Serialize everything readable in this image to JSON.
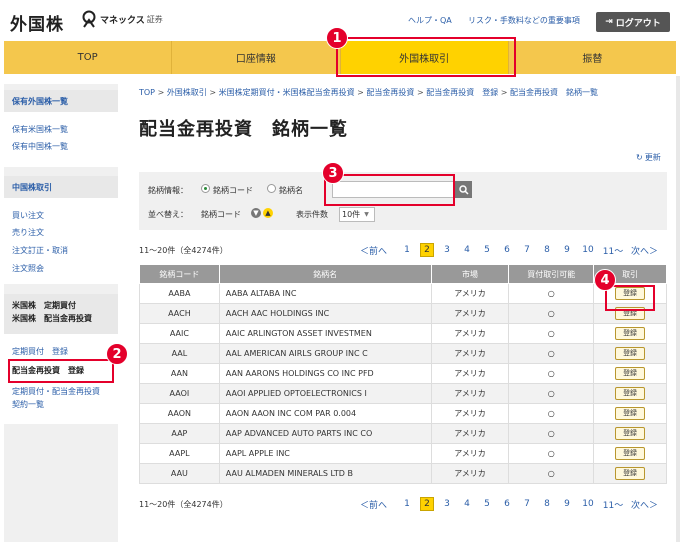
{
  "header": {
    "brand": "外国株",
    "logo_text": "マネックス",
    "logo_sub": "証券",
    "help_link": "ヘルプ・QA",
    "fees_link": "リスク・手数料などの重要事項",
    "logout_label": "ログアウト"
  },
  "nav": {
    "tabs": [
      {
        "label": "TOP"
      },
      {
        "label": "口座情報"
      },
      {
        "label": "外国株取引"
      },
      {
        "label": "振替"
      }
    ]
  },
  "sidebar": {
    "holdings_title": "保有外国株一覧",
    "holdings_us": "保有米国株一覧",
    "holdings_cn": "保有中国株一覧",
    "china_title": "中国株取引",
    "china_buy": "買い注文",
    "china_sell": "売り注文",
    "china_modify": "注文訂正・取消",
    "china_inquiry": "注文照会",
    "us_title_1": "米国株　定期買付",
    "us_title_2": "米国株　配当金再投資",
    "us_regular": "定期買付　登録",
    "us_reinvest": "配当金再投資　登録",
    "us_contract_1": "定期買付・配当金再投資",
    "us_contract_2": "契約一覧"
  },
  "breadcrumb": {
    "items": [
      "TOP",
      "外国株取引",
      "米国株定期買付・米国株配当金再投資",
      "配当金再投資",
      "配当金再投資　登録",
      "配当金再投資　銘柄一覧"
    ],
    "separator": ">"
  },
  "page_title": "配当金再投資　銘柄一覧",
  "refresh_label": "更新",
  "search": {
    "label": "銘柄情報：",
    "opt_code": "銘柄コード",
    "opt_name": "銘柄名",
    "value": "",
    "sort_label": "並べ替え：",
    "sort_value": "銘柄コード",
    "per_page_label": "表示件数",
    "per_page_value": "10件"
  },
  "results": {
    "count_text": "11～20件（全4274件）",
    "prev": "＜前へ",
    "next": "次へ＞",
    "pages": [
      "1",
      "2",
      "3",
      "4",
      "5",
      "6",
      "7",
      "8",
      "9",
      "10",
      "11～"
    ],
    "current_page": "2"
  },
  "table": {
    "headers": [
      "銘柄コード",
      "銘柄名",
      "市場",
      "買付取引可能",
      "取引"
    ],
    "rows": [
      {
        "code": "AABA",
        "name": "AABA ALTABA INC",
        "market": "アメリカ",
        "available": "○",
        "action": "登録"
      },
      {
        "code": "AACH",
        "name": "AACH AAC HOLDINGS INC",
        "market": "アメリカ",
        "available": "○",
        "action": "登録"
      },
      {
        "code": "AAIC",
        "name": "AAIC ARLINGTON ASSET INVESTMEN",
        "market": "アメリカ",
        "available": "○",
        "action": "登録"
      },
      {
        "code": "AAL",
        "name": "AAL AMERICAN AIRLS GROUP INC C",
        "market": "アメリカ",
        "available": "○",
        "action": "登録"
      },
      {
        "code": "AAN",
        "name": "AAN AARONS HOLDINGS CO INC PFD",
        "market": "アメリカ",
        "available": "○",
        "action": "登録"
      },
      {
        "code": "AAOI",
        "name": "AAOI APPLIED OPTOELECTRONICS I",
        "market": "アメリカ",
        "available": "○",
        "action": "登録"
      },
      {
        "code": "AAON",
        "name": "AAON AAON INC COM PAR 0.004",
        "market": "アメリカ",
        "available": "○",
        "action": "登録"
      },
      {
        "code": "AAP",
        "name": "AAP ADVANCED AUTO PARTS INC CO",
        "market": "アメリカ",
        "available": "○",
        "action": "登録"
      },
      {
        "code": "AAPL",
        "name": "AAPL APPLE INC",
        "market": "アメリカ",
        "available": "○",
        "action": "登録"
      },
      {
        "code": "AAU",
        "name": "AAU ALMADEN MINERALS LTD B",
        "market": "アメリカ",
        "available": "○",
        "action": "登録"
      }
    ]
  },
  "badges": [
    "1",
    "2",
    "3",
    "4"
  ],
  "colors": {
    "accent": "#ffd200",
    "nav": "#f4c74d",
    "highlight": "#e4002b",
    "link": "#2b5ea8"
  }
}
